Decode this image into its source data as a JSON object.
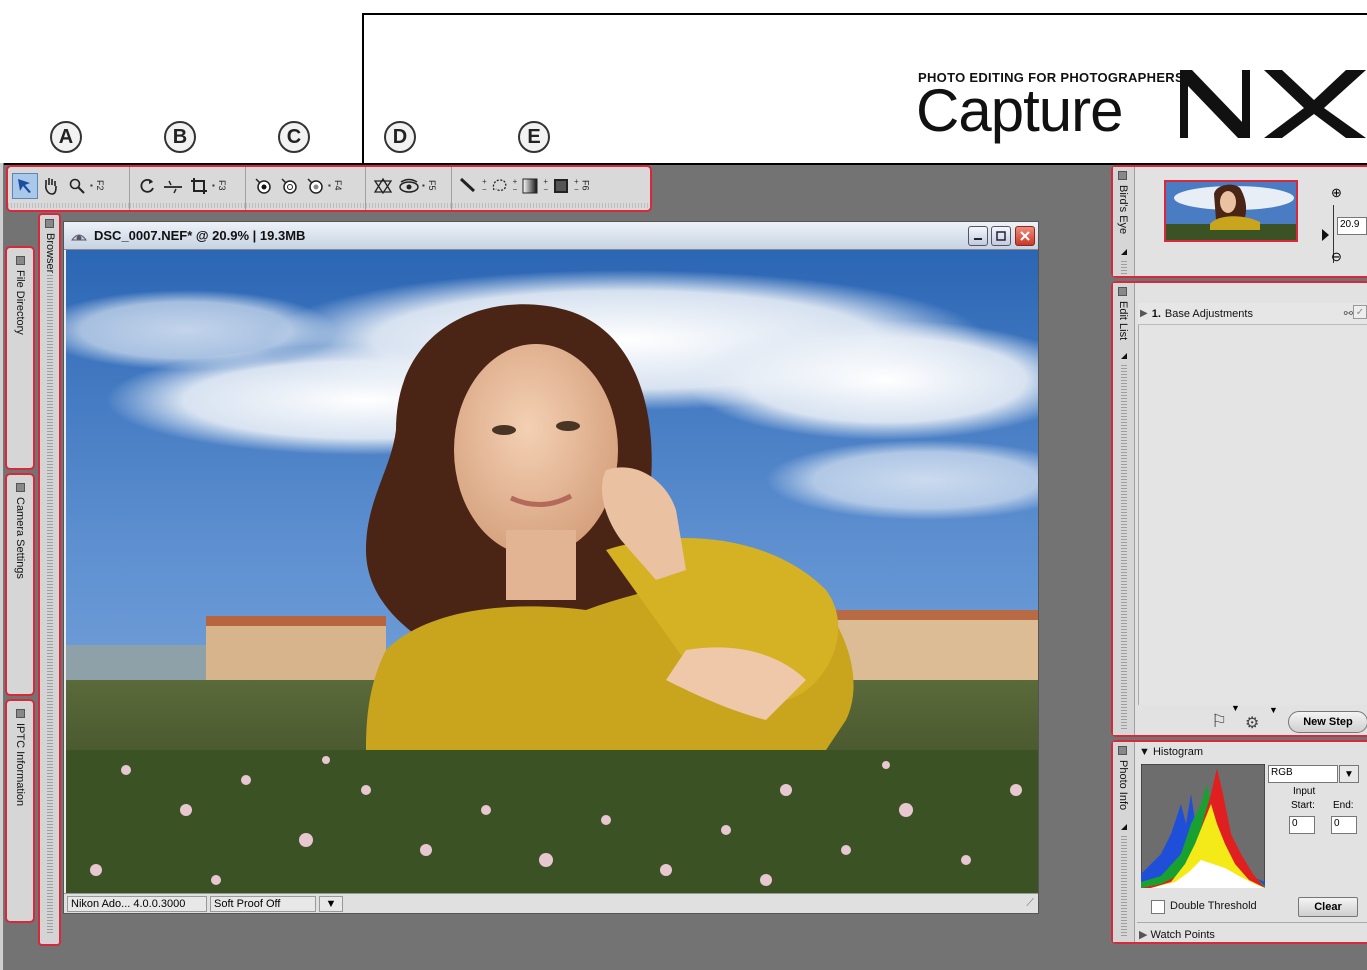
{
  "header": {
    "logo_subtitle": "PHOTO EDITING FOR PHOTOGRAPHERS",
    "logo_main": "Capture",
    "logo_suffix": "NX"
  },
  "callouts": [
    "A",
    "B",
    "C",
    "D",
    "E"
  ],
  "toolbar": {
    "groups": [
      {
        "tools": [
          "direct-selection",
          "hand",
          "zoom"
        ],
        "fkey": "F2"
      },
      {
        "tools": [
          "rotate",
          "straighten",
          "crop"
        ],
        "fkey": "F3"
      },
      {
        "tools": [
          "black-control-point",
          "white-control-point",
          "neutral-control-point"
        ],
        "fkey": "F4"
      },
      {
        "tools": [
          "red-eye-control-point",
          "auto-retouch-brush"
        ],
        "fkey": "F5"
      },
      {
        "tools": [
          "selection-brush",
          "lasso",
          "gradient",
          "marquee"
        ],
        "fkey": "F6"
      }
    ]
  },
  "left_panels": {
    "file_directory": "File Directory",
    "camera_settings": "Camera Settings",
    "iptc_information": "IPTC Information",
    "browser": "Browser"
  },
  "image_window": {
    "title": "DSC_0007.NEF* @ 20.9% | 19.3MB",
    "status_profile": "Nikon Ado... 4.0.0.3000",
    "status_proof": "Soft Proof Off"
  },
  "birds_eye": {
    "tab_label": "Bird's Eye",
    "zoom_value": "20.9"
  },
  "edit_list": {
    "tab_label": "Edit List",
    "step_number": "1.",
    "step_label": "Base Adjustments",
    "new_step_label": "New Step"
  },
  "photo_info": {
    "tab_label": "Photo Info",
    "histogram_label": "Histogram",
    "channel_value": "RGB",
    "input_label": "Input",
    "start_label": "Start:",
    "end_label": "End:",
    "start_value": "0",
    "end_value": "0",
    "double_threshold_label": "Double Threshold",
    "clear_label": "Clear",
    "watch_points_label": "Watch Points"
  },
  "colors": {
    "accent_red": "#d8283c",
    "workspace_gray": "#737373"
  }
}
